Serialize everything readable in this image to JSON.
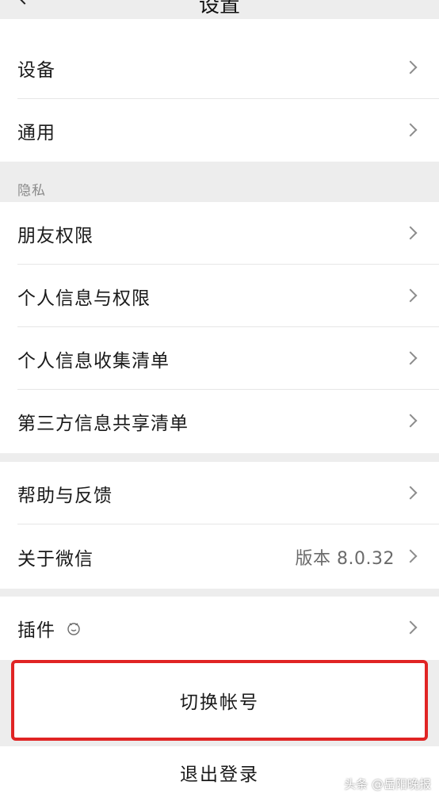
{
  "nav": {
    "title": "设置",
    "back_icon": "chevron-left-icon"
  },
  "group_top": [
    {
      "label": "设备"
    },
    {
      "label": "通用"
    }
  ],
  "privacy": {
    "header": "隐私",
    "items": [
      {
        "label": "朋友权限"
      },
      {
        "label": "个人信息与权限"
      },
      {
        "label": "个人信息收集清单"
      },
      {
        "label": "第三方信息共享清单"
      }
    ]
  },
  "group_help": [
    {
      "label": "帮助与反馈"
    },
    {
      "label": "关于微信",
      "value": "版本 8.0.32"
    }
  ],
  "plugins": {
    "label": "插件",
    "icon": "plugin-icon"
  },
  "switch_account": {
    "label": "切换帐号",
    "highlight_color": "#e02424"
  },
  "logout": {
    "label": "退出登录"
  },
  "watermark": "头条 @岳阳晚报",
  "colors": {
    "background": "#ededed",
    "card": "#ffffff",
    "text": "#1a1a1a",
    "secondary_text": "#6b6b6b"
  }
}
